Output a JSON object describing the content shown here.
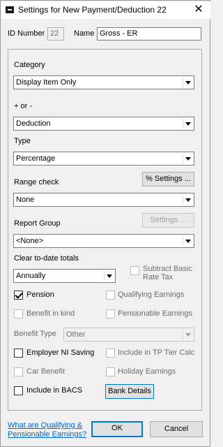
{
  "window": {
    "title": "Settings for New Payment/Deduction  22",
    "close_glyph": "✕"
  },
  "id_number": {
    "label": "ID Number",
    "value": "22"
  },
  "name": {
    "label": "Name",
    "value": "Gross - ER"
  },
  "category": {
    "label": "Category",
    "value": "Display Item Only"
  },
  "plus_minus": {
    "label": "+ or -",
    "value": "Deduction"
  },
  "type": {
    "label": "Type",
    "value": "Percentage"
  },
  "range_check": {
    "label": "Range check",
    "value": "None",
    "settings_button": "% Settings ..."
  },
  "report_group": {
    "label": "Report Group",
    "value": "<None>",
    "settings_button": "Settings ..."
  },
  "clear_totals": {
    "label": "Clear to-date totals",
    "value": "Annually"
  },
  "checkboxes": {
    "subtract_basic_line1": "Subtract Basic",
    "subtract_basic_line2": "Rate Tax",
    "pension": "Pension",
    "qualifying_earnings": "Qualifying Earnings",
    "benefit_in_kind": "Benefit in kind",
    "pensionable_earnings": "Pensionable Earnings",
    "employer_ni_saving": "Employer NI Saving",
    "include_tp_tier": "Include in TP Tier Calc",
    "car_benefit": "Car Benefit",
    "holiday_earnings": "Holiday Earnings",
    "include_bacs": "Include in BACS"
  },
  "benefit_type": {
    "label": "Benefit Type",
    "value": "Other"
  },
  "bank_details_button": "Bank Details",
  "footer": {
    "link_line1": "What are Qualifying &",
    "link_line2": "Pensionable Earnings?",
    "ok": "OK",
    "cancel": "Cancel"
  },
  "state": {
    "pension_checked": true
  }
}
